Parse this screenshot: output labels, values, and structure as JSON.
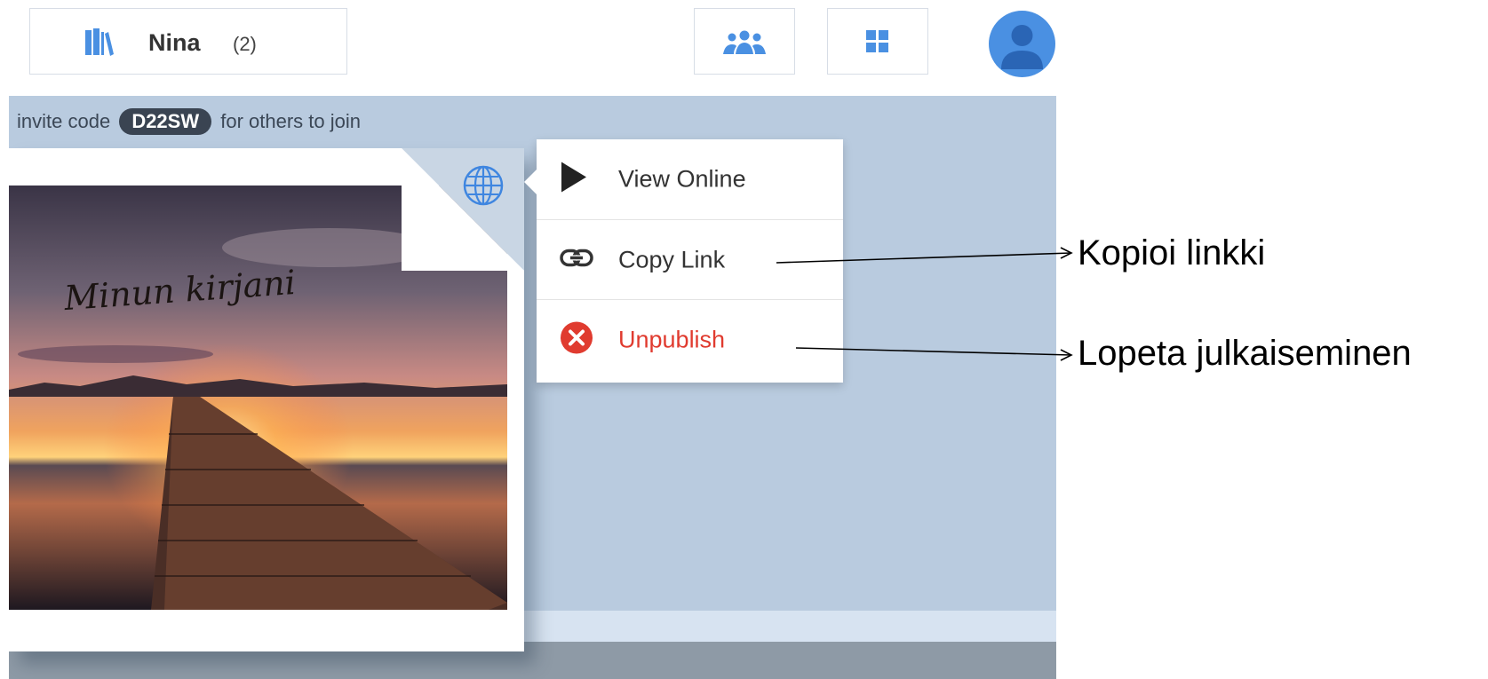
{
  "header": {
    "library_name": "Nina",
    "library_count": "(2)",
    "icons": {
      "library": "books-icon",
      "collaborators": "group-icon",
      "layout": "grid-icon",
      "profile": "user-avatar-icon"
    }
  },
  "workspace": {
    "invite_prefix": "invite code",
    "invite_code": "D22SW",
    "invite_suffix": "for others to join"
  },
  "book": {
    "cover_title": "Minun kirjani",
    "status_icon": "globe-icon"
  },
  "menu": {
    "items": [
      {
        "label": "View Online",
        "icon": "play-icon"
      },
      {
        "label": "Copy Link",
        "icon": "link-icon"
      },
      {
        "label": "Unpublish",
        "icon": "unpublish-icon"
      }
    ]
  },
  "annotations": {
    "copy_link_fi": "Kopioi linkki",
    "unpublish_fi": "Lopeta julkaiseminen"
  },
  "colors": {
    "accent_blue": "#4a90e2",
    "danger_red": "#e03b2f",
    "workspace_bg": "#b9cbdf"
  }
}
